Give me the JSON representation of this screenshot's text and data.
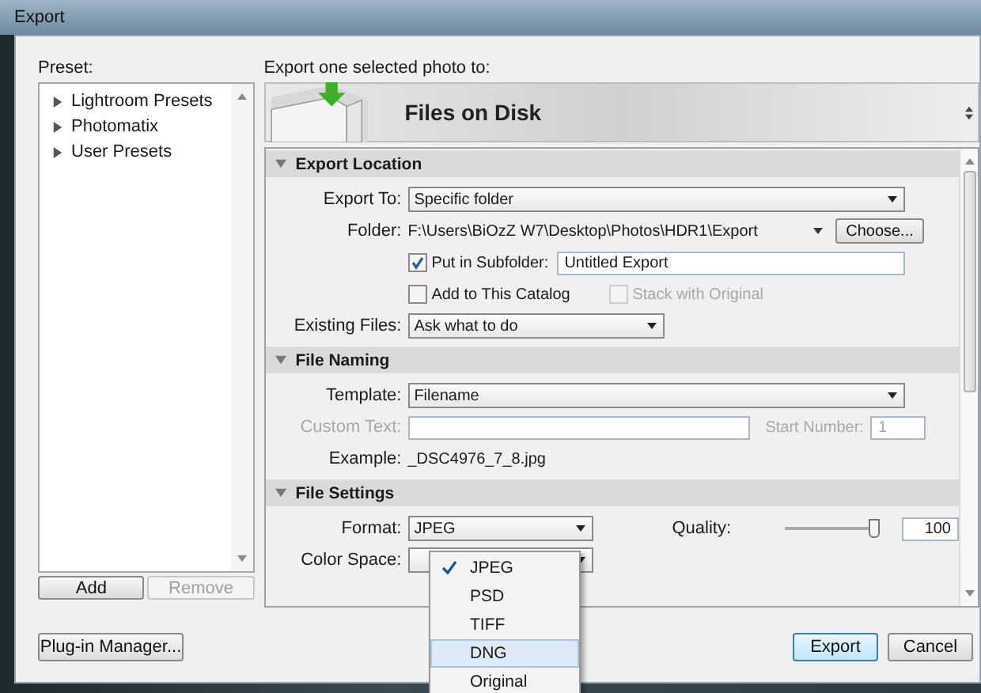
{
  "window": {
    "title": "Export"
  },
  "preset": {
    "label": "Preset:",
    "items": [
      {
        "label": "Lightroom Presets",
        "expanded": false
      },
      {
        "label": "Photomatix",
        "expanded": false
      },
      {
        "label": "User Presets",
        "expanded": false
      }
    ],
    "buttons": [
      {
        "label": "Add",
        "disabled": false
      },
      {
        "label": "Remove",
        "disabled": true
      }
    ]
  },
  "plugin_button": "Plug-in Manager...",
  "destination": {
    "label": "Export one selected photo to:",
    "title": "Files on Disk"
  },
  "sections": [
    {
      "kind": "location",
      "title": "Export Location",
      "expanded": true,
      "export_to": {
        "label": "Export To:",
        "value": "Specific folder"
      },
      "folder": {
        "label": "Folder:",
        "value": "F:\\Users\\BiOzZ W7\\Desktop\\Photos\\HDR1\\Export",
        "button": "Choose..."
      },
      "subfolder": {
        "label": "Put in Subfolder:",
        "checked": true,
        "value": "Untitled Export"
      },
      "add_catalog": {
        "label": "Add to This Catalog",
        "checked": false
      },
      "stack": {
        "label": "Stack with Original",
        "checked": false,
        "disabled": true
      },
      "existing": {
        "label": "Existing Files:",
        "value": "Ask what to do"
      }
    },
    {
      "kind": "naming",
      "title": "File Naming",
      "expanded": true,
      "template": {
        "label": "Template:",
        "value": "Filename"
      },
      "custom_text": {
        "label": "Custom Text:",
        "disabled": true
      },
      "start_number": {
        "label": "Start Number:",
        "value": "1",
        "disabled": true
      },
      "example": {
        "label": "Example:",
        "value": "_DSC4976_7_8.jpg"
      }
    },
    {
      "kind": "settings",
      "title": "File Settings",
      "expanded": true,
      "format": {
        "label": "Format:",
        "value": "JPEG"
      },
      "quality": {
        "label": "Quality:",
        "level": 1,
        "value": "100"
      },
      "color_space": {
        "label": "Color Space:"
      }
    }
  ],
  "format_menu": {
    "items": [
      {
        "label": "JPEG",
        "checked": true,
        "selected": false
      },
      {
        "label": "PSD",
        "checked": false,
        "selected": false
      },
      {
        "label": "TIFF",
        "checked": false,
        "selected": false
      },
      {
        "label": "DNG",
        "checked": false,
        "selected": true
      },
      {
        "label": "Original",
        "checked": false,
        "selected": false
      }
    ]
  },
  "buttons": [
    {
      "label": "Export",
      "default": true
    },
    {
      "label": "Cancel",
      "default": false
    }
  ]
}
